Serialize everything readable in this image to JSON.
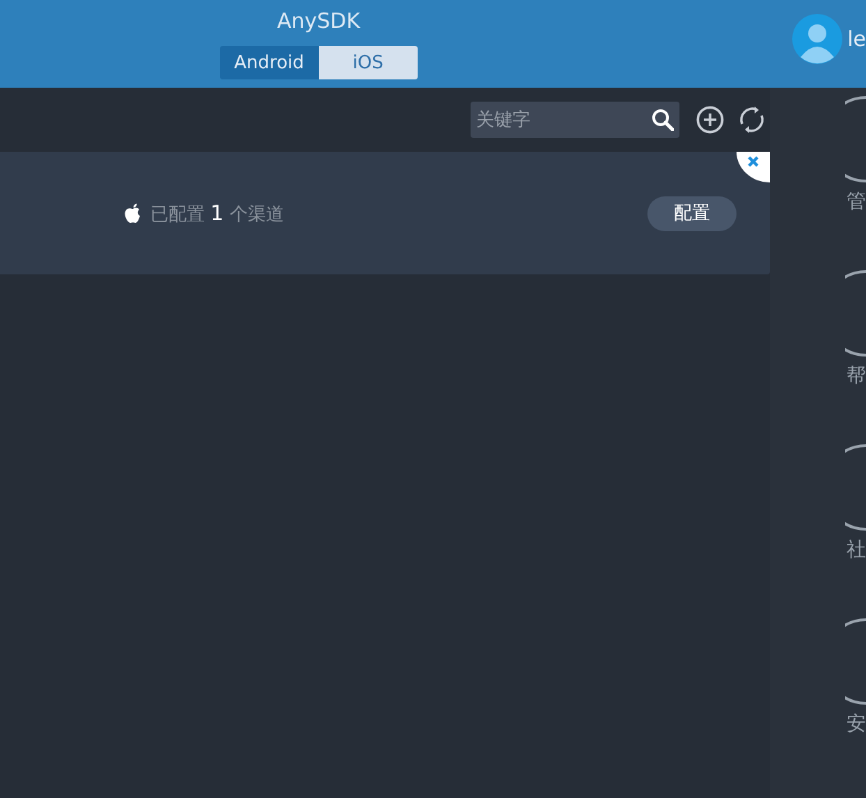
{
  "header": {
    "title": "AnySDK",
    "tabs": [
      {
        "label": "Android",
        "selected": false
      },
      {
        "label": "iOS",
        "selected": true
      }
    ],
    "user": "le"
  },
  "toolbar": {
    "search": {
      "placeholder": "关键字"
    }
  },
  "cards": [
    {
      "status": {
        "prefix": "已配置",
        "count": "1",
        "suffix": "个渠道"
      },
      "button": "配置"
    }
  ],
  "sidebar": {
    "items": [
      {
        "label": "管"
      },
      {
        "label": "帮"
      },
      {
        "label": "社"
      },
      {
        "label": "安"
      }
    ]
  }
}
